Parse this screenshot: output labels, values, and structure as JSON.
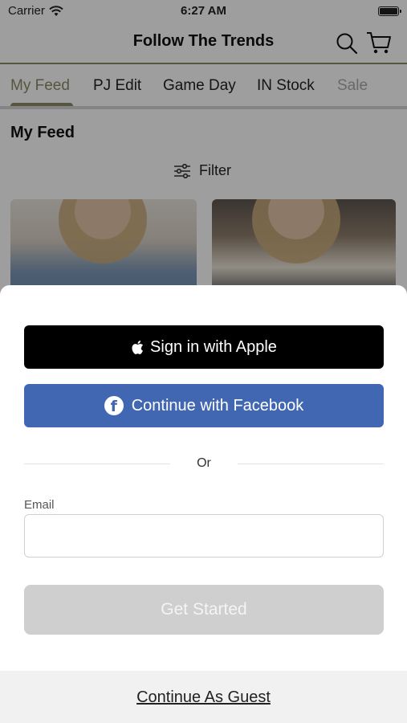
{
  "status_bar": {
    "carrier": "Carrier",
    "time": "6:27 AM"
  },
  "header": {
    "title": "Follow The Trends"
  },
  "tabs": [
    {
      "label": "My Feed",
      "active": true
    },
    {
      "label": "PJ Edit",
      "active": false
    },
    {
      "label": "Game Day",
      "active": false
    },
    {
      "label": "IN Stock",
      "active": false
    },
    {
      "label": "Sale",
      "active": false
    }
  ],
  "feed": {
    "heading": "My Feed",
    "filter_label": "Filter"
  },
  "auth_sheet": {
    "apple_button": "Sign in with Apple",
    "facebook_button": "Continue with Facebook",
    "divider_text": "Or",
    "email_label": "Email",
    "email_value": "",
    "email_placeholder": "",
    "get_started_button": "Get Started",
    "guest_link": "Continue As Guest"
  },
  "colors": {
    "accent": "#8c8a66",
    "apple_button": "#000000",
    "facebook_button": "#4267b2",
    "disabled_button": "#cfcfcf"
  },
  "icons": {
    "signal": "wifi-icon",
    "battery": "battery-icon",
    "search": "search-icon",
    "cart": "cart-icon",
    "filter": "sliders-icon",
    "apple": "apple-logo-icon",
    "facebook": "facebook-logo-icon"
  }
}
